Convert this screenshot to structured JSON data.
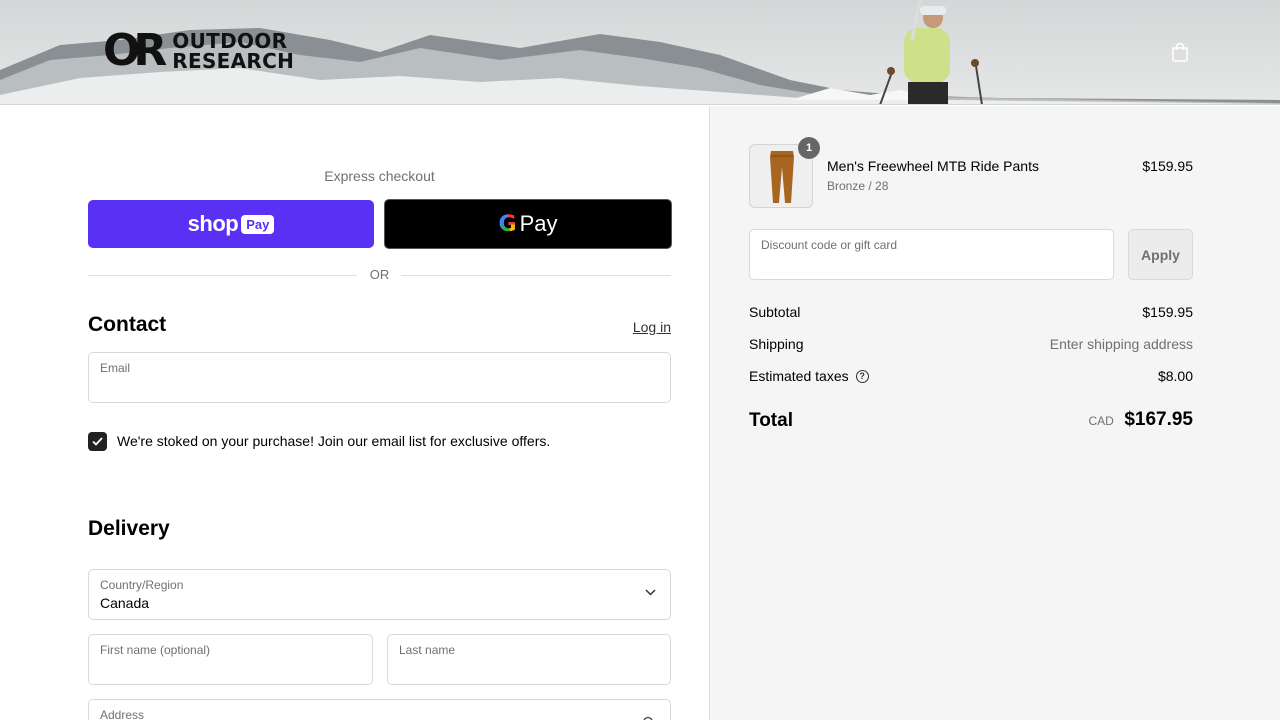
{
  "header": {
    "logo_mark": "OR",
    "logo_line1": "OUTDOOR",
    "logo_line2": "RESEARCH",
    "cart_icon": "shopping-bag-icon"
  },
  "express": {
    "title": "Express checkout",
    "shop_pay": {
      "word": "shop",
      "badge": "Pay"
    },
    "google_pay": {
      "g": "G",
      "word": "Pay"
    },
    "or_label": "OR"
  },
  "contact": {
    "title": "Contact",
    "login_link": "Log in",
    "email_label": "Email",
    "email_value": "",
    "newsletter_checked": true,
    "newsletter_label": "We're stoked on your purchase! Join our email list for exclusive offers."
  },
  "delivery": {
    "title": "Delivery",
    "country_label": "Country/Region",
    "country_value": "Canada",
    "first_name_label": "First name (optional)",
    "last_name_label": "Last name",
    "address_label": "Address"
  },
  "order": {
    "item": {
      "quantity": "1",
      "name": "Men's Freewheel MTB Ride Pants",
      "variant": "Bronze / 28",
      "price": "$159.95",
      "color": "#a8651f"
    },
    "discount_label": "Discount code or gift card",
    "apply_label": "Apply",
    "subtotal_label": "Subtotal",
    "subtotal_value": "$159.95",
    "shipping_label": "Shipping",
    "shipping_value": "Enter shipping address",
    "taxes_label": "Estimated taxes",
    "taxes_help_icon": "question-circle-icon",
    "taxes_value": "$8.00",
    "total_label": "Total",
    "total_currency": "CAD",
    "total_value": "$167.95"
  },
  "colors": {
    "shop_pay": "#5a31f4",
    "google_pay": "#000000",
    "summary_bg": "#f5f5f5"
  }
}
